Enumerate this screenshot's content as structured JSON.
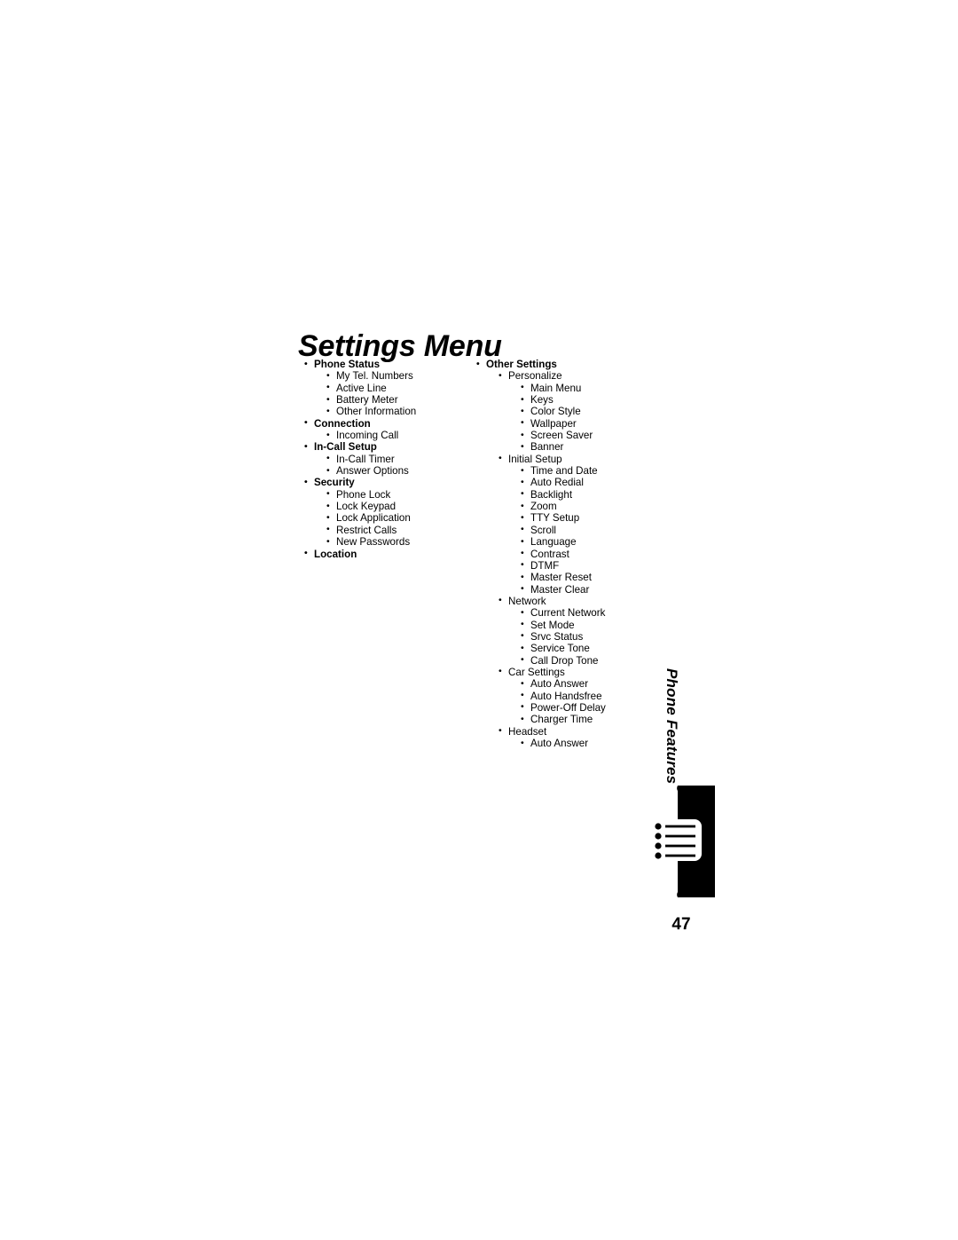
{
  "document": {
    "title": "Settings Menu",
    "page_number": "47",
    "side_tab_label": "Phone Features",
    "background_color": "#ffffff",
    "text_color": "#000000",
    "tab_color": "#000000"
  },
  "outline": {
    "left_column": [
      {
        "label": "Phone Status",
        "level": 1,
        "children": [
          {
            "label": "My Tel. Numbers",
            "level": 2
          },
          {
            "label": "Active Line",
            "level": 2
          },
          {
            "label": "Battery Meter",
            "level": 2
          },
          {
            "label": "Other Information",
            "level": 2
          }
        ]
      },
      {
        "label": "Connection",
        "level": 1,
        "children": [
          {
            "label": "Incoming Call",
            "level": 2
          }
        ]
      },
      {
        "label": "In-Call Setup",
        "level": 1,
        "children": [
          {
            "label": "In-Call Timer",
            "level": 2
          },
          {
            "label": "Answer Options",
            "level": 2
          }
        ]
      },
      {
        "label": "Security",
        "level": 1,
        "children": [
          {
            "label": "Phone Lock",
            "level": 2
          },
          {
            "label": "Lock Keypad",
            "level": 2
          },
          {
            "label": "Lock Application",
            "level": 2
          },
          {
            "label": "Restrict Calls",
            "level": 2
          },
          {
            "label": "New Passwords",
            "level": 2
          }
        ]
      },
      {
        "label": "Location",
        "level": 1,
        "children": []
      }
    ],
    "right_column": [
      {
        "label": "Other Settings",
        "level": 1,
        "children": [
          {
            "label": "Personalize",
            "level": 2,
            "children": [
              {
                "label": "Main Menu",
                "level": 3
              },
              {
                "label": "Keys",
                "level": 3
              },
              {
                "label": "Color Style",
                "level": 3
              },
              {
                "label": "Wallpaper",
                "level": 3
              },
              {
                "label": "Screen Saver",
                "level": 3
              },
              {
                "label": "Banner",
                "level": 3
              }
            ]
          },
          {
            "label": "Initial Setup",
            "level": 2,
            "children": [
              {
                "label": "Time and Date",
                "level": 3
              },
              {
                "label": "Auto Redial",
                "level": 3
              },
              {
                "label": "Backlight",
                "level": 3
              },
              {
                "label": "Zoom",
                "level": 3
              },
              {
                "label": "TTY Setup",
                "level": 3
              },
              {
                "label": "Scroll",
                "level": 3
              },
              {
                "label": "Language",
                "level": 3
              },
              {
                "label": "Contrast",
                "level": 3
              },
              {
                "label": "DTMF",
                "level": 3
              },
              {
                "label": "Master Reset",
                "level": 3
              },
              {
                "label": "Master Clear",
                "level": 3
              }
            ]
          },
          {
            "label": "Network",
            "level": 2,
            "children": [
              {
                "label": "Current Network",
                "level": 3
              },
              {
                "label": "Set Mode",
                "level": 3
              },
              {
                "label": "Srvc Status",
                "level": 3
              },
              {
                "label": "Service Tone",
                "level": 3
              },
              {
                "label": "Call Drop Tone",
                "level": 3
              }
            ]
          },
          {
            "label": "Car Settings",
            "level": 2,
            "children": [
              {
                "label": "Auto Answer",
                "level": 3
              },
              {
                "label": "Auto Handsfree",
                "level": 3
              },
              {
                "label": "Power-Off Delay",
                "level": 3
              },
              {
                "label": "Charger Time",
                "level": 3
              }
            ]
          },
          {
            "label": "Headset",
            "level": 2,
            "children": [
              {
                "label": "Auto Answer",
                "level": 3
              }
            ]
          }
        ]
      }
    ]
  }
}
